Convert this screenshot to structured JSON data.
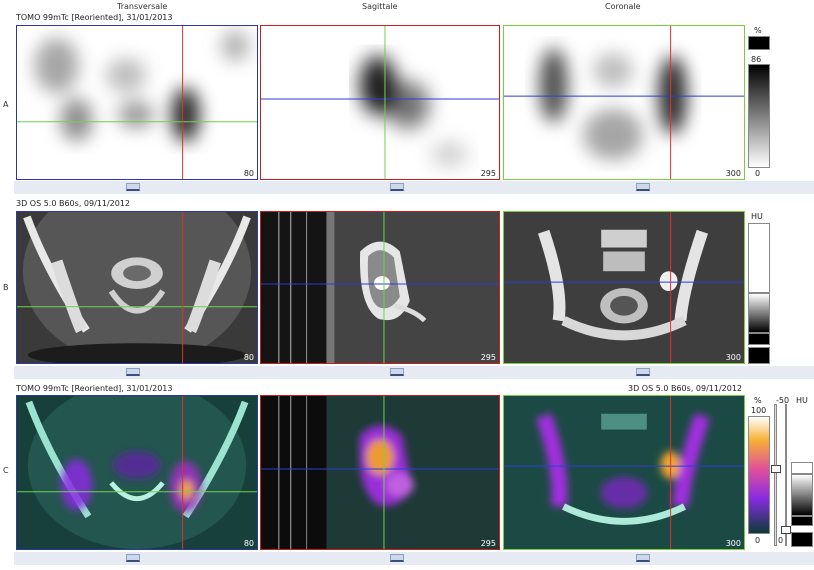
{
  "columns": {
    "transversale": "Transversale",
    "sagittale": "Sagittale",
    "coronale": "Coronale"
  },
  "rows": {
    "a": {
      "label": "A",
      "title": "TOMO 99mTc [Reoriented], 31/01/2013",
      "slices": {
        "transversale": "80",
        "sagittale": "295",
        "coronale": "300"
      }
    },
    "b": {
      "label": "B",
      "title": "3D  OS  5.0  B60s, 09/11/2012",
      "slices": {
        "transversale": "80",
        "sagittale": "295",
        "coronale": "300"
      }
    },
    "c": {
      "label": "C",
      "title_left": "TOMO 99mTc [Reoriented], 31/01/2013",
      "title_right": "3D  OS  5.0  B60s, 09/11/2012",
      "slices": {
        "transversale": "80",
        "sagittale": "295",
        "coronale": "300"
      }
    }
  },
  "scales": {
    "a": {
      "unit": "%",
      "level": "86",
      "bottom": "0"
    },
    "b": {
      "unit": "HU"
    },
    "c": {
      "unit": "%",
      "top": "100",
      "bottom": "0",
      "ct_unit": "HU",
      "ct_value": "-50",
      "ct_bottom": "0"
    }
  },
  "colors": {
    "transversale_frame": "#2b3aa0",
    "sagittale_frame": "#c81e1e",
    "coronale_frame": "#7ccc3c",
    "cross_red": "#e0302a",
    "cross_green": "#6fd24a",
    "cross_blue": "#2a3fd6"
  }
}
